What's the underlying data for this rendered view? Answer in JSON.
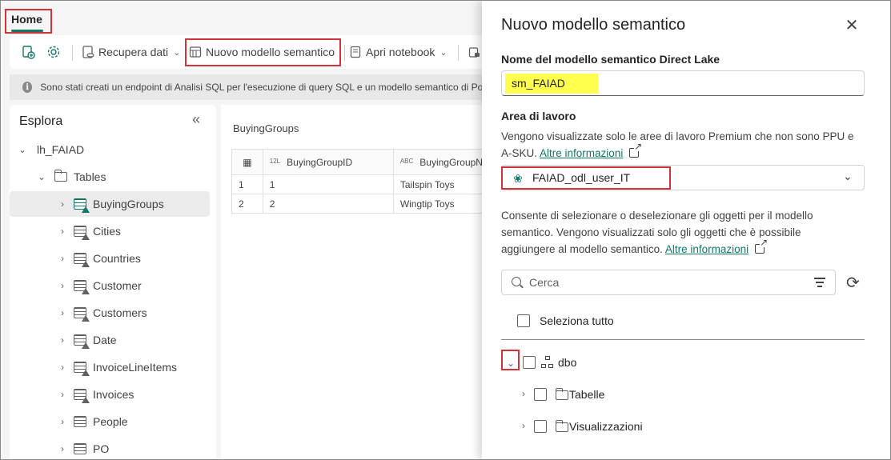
{
  "tabs": {
    "home": "Home"
  },
  "ribbon": {
    "get_data": "Recupera dati",
    "new_model": "Nuovo modello semantico",
    "open_notebook": "Apri notebook"
  },
  "info_bar": {
    "message": "Sono stati creati un endpoint di Analisi SQL per l'esecuzione di query SQL e un modello semantico di Pow"
  },
  "explorer": {
    "title": "Esplora",
    "lakehouse": "lh_FAIAD",
    "tables_folder": "Tables",
    "tables": [
      "BuyingGroups",
      "Cities",
      "Countries",
      "Customer",
      "Customers",
      "Date",
      "InvoiceLineItems",
      "Invoices",
      "People",
      "PO"
    ]
  },
  "preview": {
    "title": "BuyingGroups",
    "columns": [
      {
        "type": "12L",
        "name": "BuyingGroupID"
      },
      {
        "type": "ABC",
        "name": "BuyingGroupN"
      }
    ],
    "rows": [
      {
        "n": "1",
        "id": "1",
        "name": "Tailspin Toys"
      },
      {
        "n": "2",
        "id": "2",
        "name": "Wingtip Toys"
      }
    ]
  },
  "panel": {
    "title": "Nuovo modello semantico",
    "name_label": "Nome del modello semantico Direct Lake",
    "name_value": "sm_FAIAD",
    "workspace_label": "Area di lavoro",
    "workspace_desc_1": "Vengono visualizzate solo le aree di lavoro Premium che non sono PPU e",
    "workspace_desc_2": "A-SKU.",
    "more_info": "Altre informazioni",
    "workspace_value": "FAIAD_odl_user_IT",
    "objects_desc_1": "Consente di selezionare o deselezionare gli oggetti per il modello",
    "objects_desc_2": "semantico. Vengono visualizzati solo gli oggetti che è possibile",
    "objects_desc_3": "aggiungere al modello semantico.",
    "search_placeholder": "Cerca",
    "select_all": "Seleziona tutto",
    "schema": "dbo",
    "folder_tables": "Tabelle",
    "folder_views": "Visualizzazioni"
  },
  "colors": {
    "accent": "#117865",
    "highlight": "#ffff4d",
    "annotation": "#d13438"
  }
}
